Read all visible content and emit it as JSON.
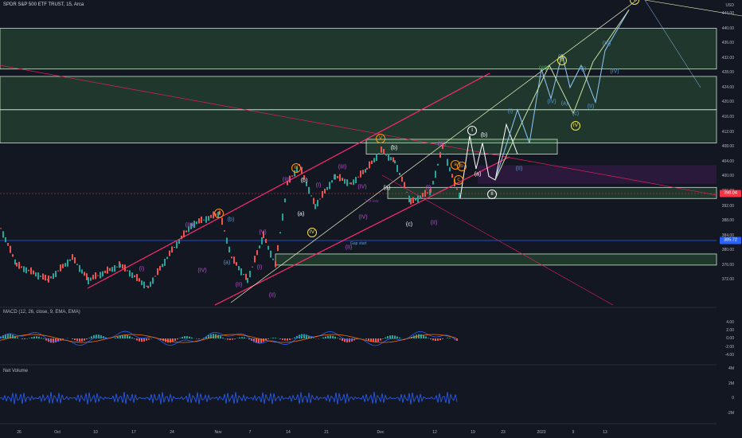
{
  "header": {
    "title": "SPDR S&P 500 ETF TRUST, 15, Arca"
  },
  "price_axis": {
    "unit": "USD",
    "ticks": [
      "444.00",
      "440.00",
      "436.00",
      "432.00",
      "428.00",
      "424.00",
      "420.00",
      "416.00",
      "412.00",
      "408.00",
      "404.00",
      "400.00",
      "396.00",
      "392.00",
      "388.00",
      "384.00",
      "380.00",
      "376.00",
      "372.00"
    ],
    "current_price": "398.04",
    "gap_price": "385.72",
    "current_color": "#f23645",
    "gap_color": "#2962ff"
  },
  "time_axis": {
    "ticks": [
      "26",
      "Oct",
      "10",
      "17",
      "24",
      "Nov",
      "7",
      "14",
      "21",
      "Dec",
      "12",
      "19",
      "23",
      "2023",
      "9",
      "13"
    ]
  },
  "annotations": {
    "gap_start": "Gap start",
    "one_hr": "1 hr low"
  },
  "macd": {
    "title": "MACD (12, 26, close, 9, EMA, EMA)",
    "ticks": [
      "4.00",
      "2.00",
      "0.00",
      "-2.00",
      "-4.00"
    ]
  },
  "volume": {
    "title": "Net Volume",
    "ticks": [
      "4M",
      "2M",
      "0",
      "-2M"
    ]
  },
  "waves": [
    {
      "t": "(I)",
      "c": "purple"
    },
    {
      "t": "(III)",
      "c": "purple"
    },
    {
      "t": "(II)",
      "c": "purple"
    },
    {
      "t": "I",
      "c": "orange"
    },
    {
      "t": "(b)",
      "c": "blue"
    },
    {
      "t": "(a)",
      "c": "blue"
    },
    {
      "t": "(IV)",
      "c": "purple"
    },
    {
      "t": "(V)",
      "c": "purple"
    },
    {
      "t": "(I)",
      "c": "purple"
    },
    {
      "t": "(II)",
      "c": "purple"
    },
    {
      "t": "(III)",
      "c": "purple"
    },
    {
      "t": "III",
      "c": "orange"
    },
    {
      "t": "(b)",
      "c": "white"
    },
    {
      "t": "(a)",
      "c": "white"
    },
    {
      "t": "IV",
      "c": "yellow"
    },
    {
      "t": "(IV)",
      "c": "purple"
    },
    {
      "t": "(I)",
      "c": "purple"
    },
    {
      "t": "(II)",
      "c": "purple"
    },
    {
      "t": "(III)",
      "c": "purple"
    },
    {
      "t": "(IV)",
      "c": "purple"
    },
    {
      "t": "V",
      "c": "orange"
    },
    {
      "t": "(b)",
      "c": "white"
    },
    {
      "t": "(a)",
      "c": "white"
    },
    {
      "t": "(c)",
      "c": "white"
    },
    {
      "t": "(I)",
      "c": "purple"
    },
    {
      "t": "(II)",
      "c": "purple"
    },
    {
      "t": "(III)",
      "c": "purple"
    },
    {
      "t": "a",
      "c": "orange"
    },
    {
      "t": "b",
      "c": "orange"
    },
    {
      "t": "c",
      "c": "orange"
    },
    {
      "t": "I",
      "c": "white"
    },
    {
      "t": "(b)",
      "c": "white"
    },
    {
      "t": "(a)",
      "c": "white"
    },
    {
      "t": "II",
      "c": "white"
    },
    {
      "t": "(I)",
      "c": "blue"
    },
    {
      "t": "(II)",
      "c": "blue"
    },
    {
      "t": "(III)",
      "c": "green"
    },
    {
      "t": "(IV)",
      "c": "blue"
    },
    {
      "t": "(a)",
      "c": "blue"
    },
    {
      "t": "(b)",
      "c": "blue"
    },
    {
      "t": "(c)",
      "c": "blue"
    },
    {
      "t": "III",
      "c": "yellow"
    },
    {
      "t": "IV",
      "c": "yellow"
    },
    {
      "t": "(I)",
      "c": "blue"
    },
    {
      "t": "(II)",
      "c": "blue"
    },
    {
      "t": "(III)",
      "c": "blue"
    },
    {
      "t": "(IV)",
      "c": "blue"
    },
    {
      "t": "V",
      "c": "yellow"
    }
  ],
  "colors": {
    "purple": "#c04fd6",
    "orange": "#ff9800",
    "blue": "#5b9bd5",
    "white": "#ffffff",
    "yellow": "#f5e34b",
    "green": "#4caf50"
  }
}
